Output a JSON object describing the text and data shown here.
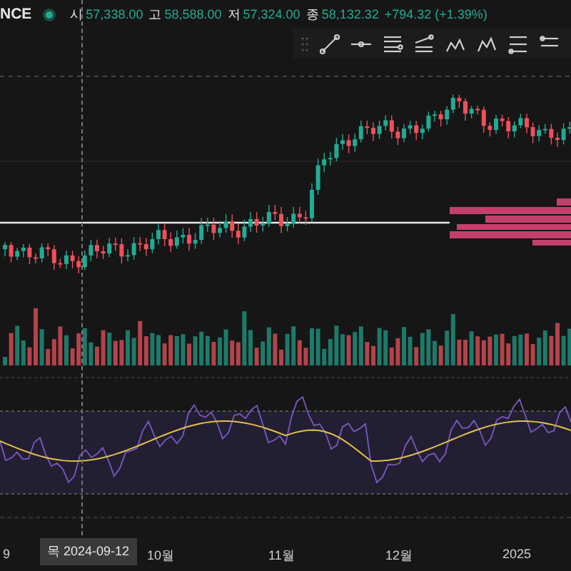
{
  "symbol": "NCE",
  "ohlc": [
    {
      "label": "시",
      "value": "57,338.00"
    },
    {
      "label": "고",
      "value": "58,588.00"
    },
    {
      "label": "저",
      "value": "57,324.00"
    },
    {
      "label": "종",
      "value": "58,132.32"
    }
  ],
  "change": "+794.32 (+1.39%)",
  "time_axis": [
    "9",
    "10월",
    "11월",
    "12월",
    "2025"
  ],
  "crosshair_label": "목 2024-09-12"
}
